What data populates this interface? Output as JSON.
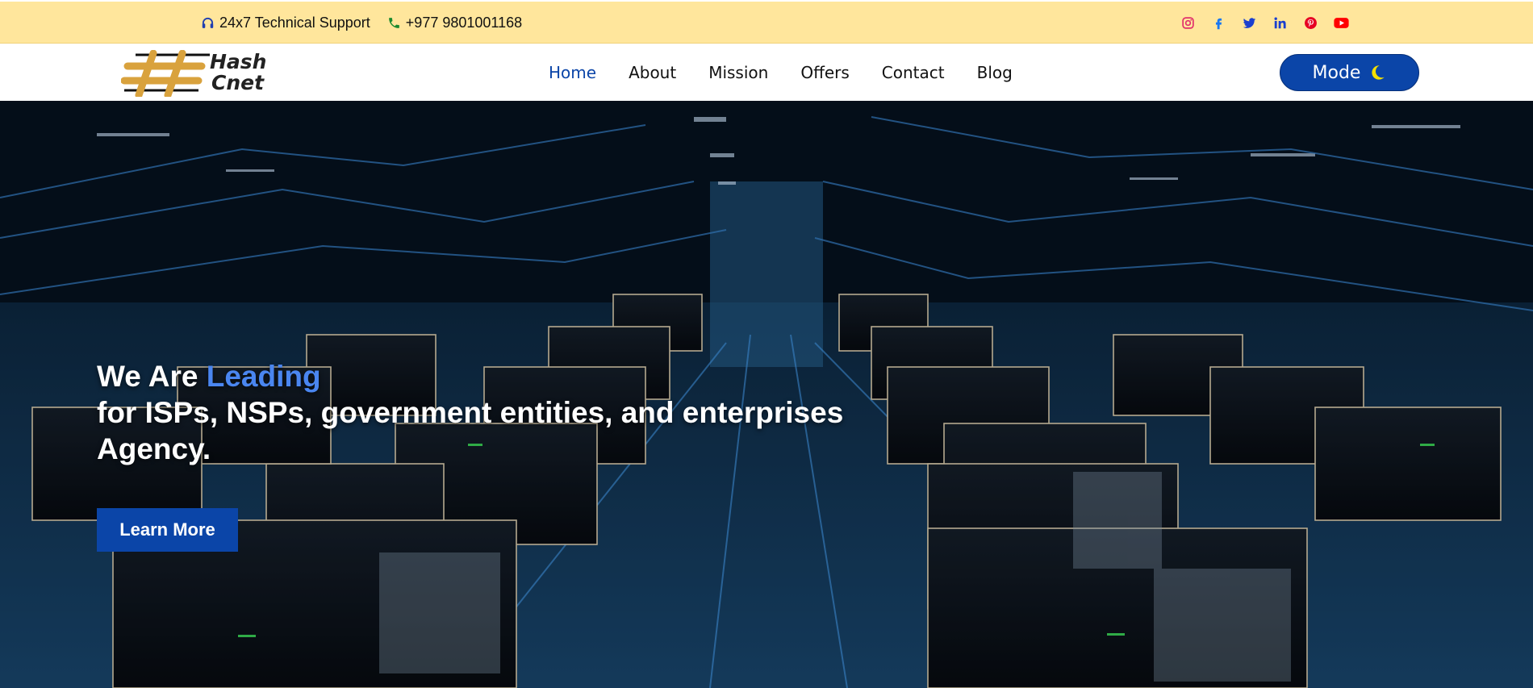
{
  "topbar": {
    "support_label": "24x7 Technical Support",
    "phone_label": "+977 9801001168",
    "socials": [
      {
        "icon": "instagram-icon",
        "color": "#e1306c"
      },
      {
        "icon": "facebook-icon",
        "color": "#1877f2"
      },
      {
        "icon": "twitter-icon",
        "color": "#1da1f2"
      },
      {
        "icon": "linkedin-icon",
        "color": "#0a66c2"
      },
      {
        "icon": "pinterest-icon",
        "color": "#e60023"
      },
      {
        "icon": "youtube-icon",
        "color": "#ff0000"
      }
    ]
  },
  "logo": {
    "line1": "Hash",
    "line2": "Cnet"
  },
  "nav": {
    "items": [
      {
        "label": "Home",
        "active": true
      },
      {
        "label": "About"
      },
      {
        "label": "Mission"
      },
      {
        "label": "Offers"
      },
      {
        "label": "Contact"
      },
      {
        "label": "Blog"
      }
    ],
    "mode_label": "Mode",
    "mode_icon": "moon-icon"
  },
  "hero": {
    "heading_prefix": "We Are ",
    "heading_accent": "Leading",
    "line2": "for ISPs, NSPs, government entities, and enterprises",
    "line3": "Agency.",
    "cta_label": "Learn More",
    "background": "data-center server racks image"
  },
  "colors": {
    "topbar_bg": "#ffe69c",
    "primary": "#0b45a8",
    "accent_text": "#4a86f0",
    "phone_icon": "#1a8a2e",
    "moon": "#f5e000"
  }
}
